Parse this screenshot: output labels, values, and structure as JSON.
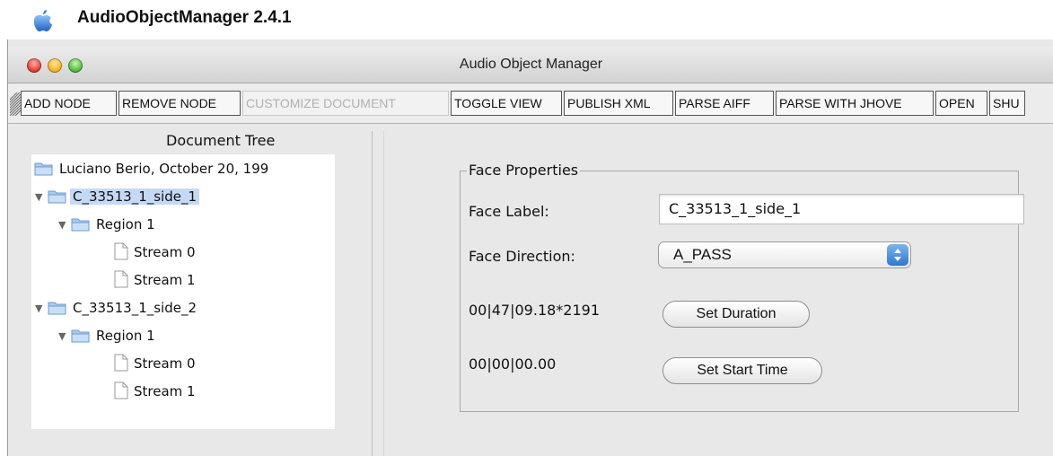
{
  "menubar": {
    "app_name": "AudioObjectManager 2.4.1",
    "icon": "apple-icon"
  },
  "window": {
    "title": "Audio Object Manager"
  },
  "toolbar": {
    "buttons": [
      {
        "label": "ADD NODE",
        "enabled": true
      },
      {
        "label": "REMOVE NODE",
        "enabled": true
      },
      {
        "label": "CUSTOMIZE DOCUMENT",
        "enabled": false
      },
      {
        "label": "TOGGLE VIEW",
        "enabled": true
      },
      {
        "label": "PUBLISH XML",
        "enabled": true
      },
      {
        "label": "PARSE AIFF",
        "enabled": true
      },
      {
        "label": "PARSE WITH JHOVE",
        "enabled": true
      },
      {
        "label": "OPEN",
        "enabled": true
      },
      {
        "label": "SHU",
        "enabled": true
      }
    ]
  },
  "tree": {
    "title": "Document Tree",
    "nodes": [
      {
        "label": "Luciano Berio, October 20, 199",
        "type": "folder",
        "expanded": false,
        "selected": false
      },
      {
        "label": "C_33513_1_side_1",
        "type": "folder",
        "expanded": true,
        "selected": true
      },
      {
        "label": "Region 1",
        "type": "folder",
        "expanded": true,
        "selected": false
      },
      {
        "label": "Stream 0",
        "type": "file",
        "selected": false
      },
      {
        "label": "Stream 1",
        "type": "file",
        "selected": false
      },
      {
        "label": "C_33513_1_side_2",
        "type": "folder",
        "expanded": true,
        "selected": false
      },
      {
        "label": "Region 1",
        "type": "folder",
        "expanded": true,
        "selected": false
      },
      {
        "label": "Stream 0",
        "type": "file",
        "selected": false
      },
      {
        "label": "Stream 1",
        "type": "file",
        "selected": false
      }
    ]
  },
  "face": {
    "group_title": "Face Properties",
    "label_caption": "Face Label:",
    "label_value": "C_33513_1_side_1",
    "direction_caption": "Face Direction:",
    "direction_value": "A_PASS",
    "duration_value": "00|47|09.18*2191",
    "set_duration_label": "Set Duration",
    "start_value": "00|00|00.00",
    "set_start_label": "Set Start Time"
  },
  "colors": {
    "selection": "#c5d9f5",
    "select_accent": "#2e78d1",
    "window_bg": "#e8e8e8"
  }
}
